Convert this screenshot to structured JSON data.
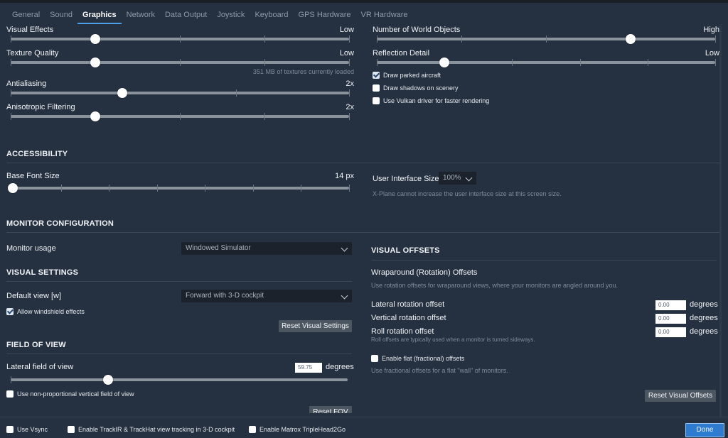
{
  "tabs": [
    "General",
    "Sound",
    "Graphics",
    "Network",
    "Data Output",
    "Joystick",
    "Keyboard",
    "GPS Hardware",
    "VR Hardware"
  ],
  "active_tab": "Graphics",
  "graphics": {
    "visual_effects": {
      "label": "Visual Effects",
      "value": "Low",
      "level": 0.25
    },
    "texture_quality": {
      "label": "Texture Quality",
      "value": "Low",
      "level": 0.25,
      "hint": "351 MB of textures currently loaded"
    },
    "antialiasing": {
      "label": "Antialiasing",
      "value": "2x",
      "level": 0.33
    },
    "anisotropic": {
      "label": "Anisotropic Filtering",
      "value": "2x",
      "level": 0.25
    },
    "world_objects": {
      "label": "Number of World Objects",
      "value": "High",
      "level": 0.75
    },
    "reflection": {
      "label": "Reflection Detail",
      "value": "Low",
      "level": 0.2
    },
    "checks": [
      {
        "label": "Draw parked aircraft",
        "checked": true
      },
      {
        "label": "Draw shadows on scenery",
        "checked": false
      },
      {
        "label": "Use Vulkan driver for faster rendering",
        "checked": false
      }
    ]
  },
  "accessibility": {
    "title": "ACCESSIBILITY",
    "font_size_label": "Base Font Size",
    "font_size_value": "14 px",
    "font_size_level": 0.0,
    "ui_size_label": "User Interface Size",
    "ui_size_value": "100%",
    "ui_size_hint": "X-Plane cannot increase the user interface size at this screen size."
  },
  "monitor": {
    "title": "MONITOR CONFIGURATION",
    "usage_label": "Monitor usage",
    "usage_value": "Windowed Simulator"
  },
  "visual_settings": {
    "title": "VISUAL SETTINGS",
    "default_view_label": "Default view [w]",
    "default_view_value": "Forward with 3-D cockpit",
    "windshield_label": "Allow windshield effects",
    "windshield_checked": true,
    "reset_label": "Reset Visual Settings"
  },
  "fov": {
    "title": "FIELD OF VIEW",
    "lateral_label": "Lateral field of view",
    "lateral_value": "59.75",
    "unit": "degrees",
    "lateral_level": 0.29,
    "nonprop_label": "Use non-proportional vertical field of view",
    "reset_label": "Reset FOV"
  },
  "visual_offsets": {
    "title": "VISUAL OFFSETS",
    "subtitle": "Wraparound (Rotation) Offsets",
    "description": "Use rotation offsets for wraparound views, where your monitors are angled around you.",
    "lateral_label": "Lateral rotation offset",
    "vertical_label": "Vertical rotation offset",
    "roll_label": "Roll rotation offset",
    "roll_hint": "Roll offsets are typically used when a monitor is turned sideways.",
    "lateral_value": "0.00",
    "vertical_value": "0.00",
    "roll_value": "0.00",
    "unit": "degrees",
    "flat_label": "Enable flat (fractional) offsets",
    "flat_hint": "Use fractional offsets for a flat \"wall\" of monitors.",
    "reset_label": "Reset Visual Offsets"
  },
  "bottom": {
    "vsync": "Use Vsync",
    "trackir": "Enable TrackIR & TrackHat view tracking in 3-D cockpit",
    "matrox": "Enable Matrox TripleHead2Go",
    "done": "Done"
  }
}
